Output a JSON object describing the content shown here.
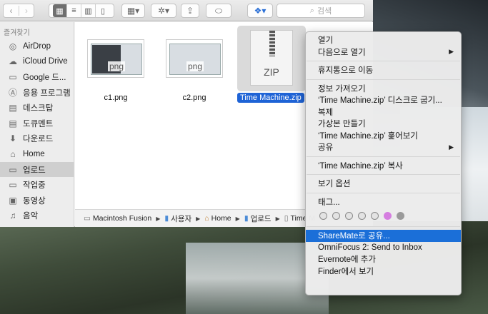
{
  "toolbar": {
    "search_placeholder": "검색"
  },
  "sidebar": {
    "header": "즐겨찾기",
    "items": [
      {
        "label": "AirDrop",
        "icon": "airdrop-icon"
      },
      {
        "label": "iCloud Drive",
        "icon": "cloud-icon"
      },
      {
        "label": "Google 드...",
        "icon": "folder-icon"
      },
      {
        "label": "응용 프로그램",
        "icon": "applications-icon"
      },
      {
        "label": "데스크탑",
        "icon": "desktop-icon"
      },
      {
        "label": "도큐멘트",
        "icon": "documents-icon"
      },
      {
        "label": "다운로드",
        "icon": "downloads-icon"
      },
      {
        "label": "Home",
        "icon": "home-icon"
      },
      {
        "label": "업로드",
        "icon": "folder-icon",
        "selected": true
      },
      {
        "label": "작업중",
        "icon": "folder-icon"
      },
      {
        "label": "동영상",
        "icon": "movies-icon"
      },
      {
        "label": "음악",
        "icon": "music-icon"
      }
    ]
  },
  "files": [
    {
      "name": "c1.png",
      "thumb_label": "png"
    },
    {
      "name": "c2.png",
      "thumb_label": "png"
    },
    {
      "name": "Time Machine.zip",
      "thumb_label": "ZIP"
    }
  ],
  "pathbar": [
    "Macintosh Fusion",
    "사용자",
    "Home",
    "업로드",
    "Time M"
  ],
  "context_menu": {
    "items": [
      {
        "label": "열기"
      },
      {
        "label": "다음으로 열기",
        "submenu": true
      },
      {
        "sep": true
      },
      {
        "label": "휴지통으로 이동"
      },
      {
        "sep": true
      },
      {
        "label": "정보 가져오기"
      },
      {
        "label": "‘Time Machine.zip’ 디스크로 굽기..."
      },
      {
        "label": "복제"
      },
      {
        "label": "가상본 만들기"
      },
      {
        "label": "‘Time Machine.zip’ 훑어보기"
      },
      {
        "label": "공유",
        "submenu": true
      },
      {
        "sep": true
      },
      {
        "label": "‘Time Machine.zip’ 복사"
      },
      {
        "sep": true
      },
      {
        "label": "보기 옵션"
      },
      {
        "sep": true
      },
      {
        "label": "태그..."
      },
      {
        "tags": true
      },
      {
        "sep": true
      },
      {
        "label": "ShareMate로 공유...",
        "highlighted": true
      },
      {
        "label": "OmniFocus 2: Send to Inbox"
      },
      {
        "label": "Evernote에 추가"
      },
      {
        "label": "Finder에서 보기"
      }
    ],
    "tag_colors": [
      "#e3e3e3",
      "#e3e3e3",
      "#e3e3e3",
      "#e3e3e3",
      "#e3e3e3",
      "#d57ee0",
      "#9a9a9a"
    ]
  }
}
